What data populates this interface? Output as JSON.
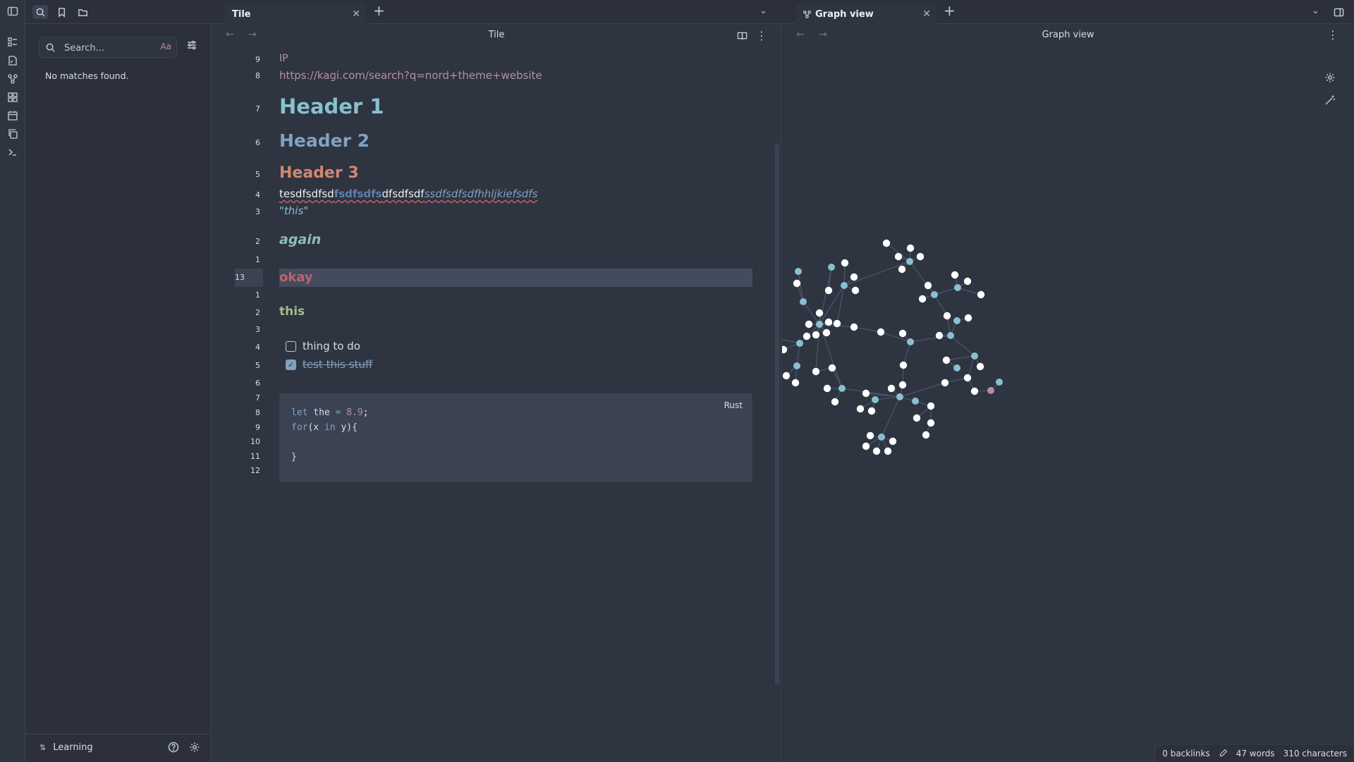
{
  "topbar": {
    "left_tab_title": "Tile",
    "right_tab_title": "Graph view"
  },
  "sidebar": {
    "search_placeholder": "Search...",
    "match_case_label": "Aa",
    "no_results": "No matches found.",
    "vault_name": "Learning"
  },
  "editor": {
    "title": "Tile",
    "gutter": [
      "9",
      "8",
      "7",
      "6",
      "5",
      "4",
      "3",
      "2",
      "1",
      "13",
      "1",
      "2",
      "3",
      "4",
      "5",
      "6",
      "7",
      "8",
      "9",
      "10",
      "11",
      "12"
    ],
    "lines": {
      "ip": "IP",
      "url": "https://kagi.com/search?q=nord+theme+website",
      "h1": "Header 1",
      "h2": "Header 2",
      "h3": "Header 3",
      "mixed_plain": "tesdfsdfsd",
      "mixed_bold": "fsdfsdfs",
      "mixed_plain2": "dfsdfsdf",
      "mixed_italic": "ssdfsdfsdfhhljkiefsdfs",
      "quote": "\"this\"",
      "again": "again",
      "okay": "okay",
      "this": "this",
      "task1": "thing to do",
      "task2": "test this stuff"
    },
    "code": {
      "language": "Rust",
      "l1_kw": "let",
      "l1_var": " the ",
      "l1_op": "=",
      "l1_num": " 8.9",
      "l1_end": ";",
      "l2_kw": "for",
      "l2_a": "(x ",
      "l2_in": "in",
      "l2_b": " y){",
      "l4": "}"
    }
  },
  "graph": {
    "title": "Graph view",
    "colors": {
      "node": "#ffffff",
      "tag": "#88c0d0",
      "active": "#b48ead",
      "edge": "#4c566a"
    }
  },
  "status": {
    "backlinks": "0 backlinks",
    "words": "47 words",
    "characters": "310 characters"
  }
}
